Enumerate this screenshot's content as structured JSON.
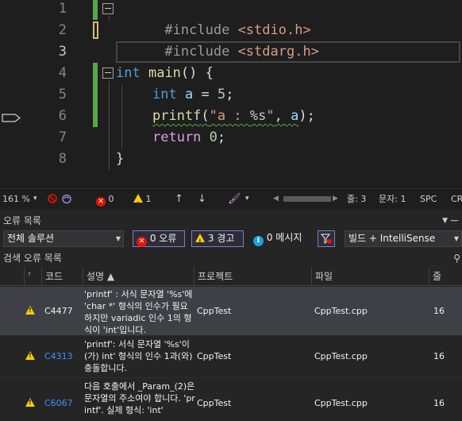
{
  "editor": {
    "lines": [
      {
        "num": "1",
        "text": "#include <stdio.h>"
      },
      {
        "num": "2",
        "text": "#include <stdarg.h>"
      },
      {
        "num": "3",
        "text": ""
      },
      {
        "num": "4",
        "text": "int main() {"
      },
      {
        "num": "5",
        "text": "    int a = 5;"
      },
      {
        "num": "6",
        "text": "    printf(\"a : %s\", a);"
      },
      {
        "num": "7",
        "text": "    return 0;"
      },
      {
        "num": "8",
        "text": "}"
      }
    ],
    "tokens": {
      "l1_pre": "#include",
      "l1_inc": "<stdio.h>",
      "l2_pre": "#include",
      "l2_inc": "<stdarg.h>",
      "l4_kw": "int",
      "l4_fn": "main",
      "l4_rest": "() {",
      "l5_kw": "int",
      "l5_var": "a",
      "l5_eq": " = ",
      "l5_num": "5",
      "l5_end": ";",
      "l6_fn": "printf",
      "l6_open": "(",
      "l6_str1": "\"a : ",
      "l6_fmt": "%s",
      "l6_str2": "\"",
      "l6_comma": ", ",
      "l6_var": "a",
      "l6_close": ");",
      "l7_ret": "return",
      "l7_num": "0",
      "l7_end": ";",
      "l8": "}"
    }
  },
  "status_bar": {
    "zoom": "161 %",
    "errors": "0",
    "warnings": "1",
    "line": "줄: 3",
    "col": "문자: 1",
    "encoding": "SPC",
    "eol": "CR"
  },
  "error_list": {
    "title": "오류 목록",
    "scope": "전체 솔루션",
    "errors_btn": "0 오류",
    "warnings_btn": "3 경고",
    "messages_btn": "0 메시지",
    "build_filter": "빌드 + IntelliSense",
    "search_label": "검색 오류 목록",
    "columns": {
      "code": "코드",
      "desc": "설명 ▲",
      "project": "프로젝트",
      "file": "파일",
      "line": "줄"
    },
    "rows": [
      {
        "code": "C4477",
        "desc": "'printf' : 서식 문자열 '%s'에 'char *' 형식의 인수가 필요하지만 variadic 인수 1의 형식이 'int'입니다.",
        "project": "CppTest",
        "file": "CppTest.cpp",
        "line": "16"
      },
      {
        "code": "C4313",
        "desc": "'printf': 서식 문자열 '%s'이(가) int' 형식의 인수 1과(와) 충돌합니다.",
        "project": "CppTest",
        "file": "CppTest.cpp",
        "line": "16"
      },
      {
        "code": "C6067",
        "desc": "다음 호출에서 _Param_(2)은 문자열의 주소여야 합니다. 'printf'. 실제 형식: 'int'",
        "project": "CppTest",
        "file": "CppTest.cpp",
        "line": "16"
      }
    ]
  },
  "colors": {
    "keyword": "#569cd6",
    "string": "#d69d85",
    "function": "#dcdcaa",
    "variable": "#9cdcfe",
    "number": "#b5cea8",
    "change_bar": "#57a64a",
    "error": "#e51400",
    "warning": "#ffcc00",
    "link": "#3794ff"
  }
}
